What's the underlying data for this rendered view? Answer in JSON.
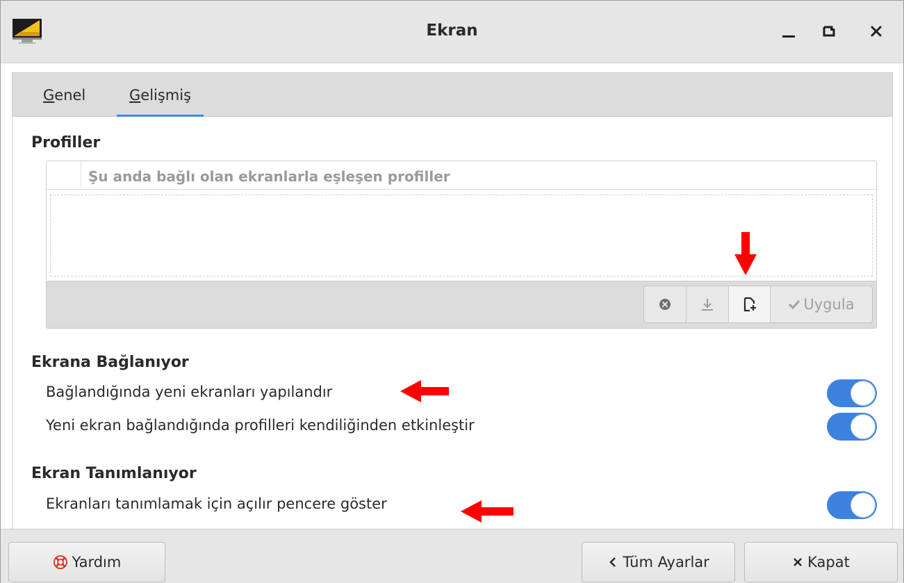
{
  "window": {
    "title": "Ekran",
    "icon": "display-settings-icon"
  },
  "tabs": [
    {
      "label": "Genel",
      "underline_char": "G",
      "active": false
    },
    {
      "label": "Gelişmiş",
      "underline_char": "G",
      "active": true
    }
  ],
  "profiles": {
    "heading": "Profiller",
    "column_title": "Şu anda bağlı olan ekranlarla eşleşen profiller",
    "items": [],
    "toolbar": {
      "delete_icon": "delete-circle-icon",
      "save_icon": "download-icon",
      "new_icon": "new-document-icon",
      "apply_label": "Uygula",
      "apply_icon": "checkmark-icon"
    }
  },
  "connecting": {
    "heading": "Ekrana Bağlanıyor",
    "options": [
      {
        "label": "Bağlandığında yeni ekranları yapılandır",
        "enabled": true
      },
      {
        "label": "Yeni ekran bağlandığında profilleri kendiliğinden etkinleştir",
        "enabled": true
      }
    ]
  },
  "identifying": {
    "heading": "Ekran Tanımlanıyor",
    "options": [
      {
        "label": "Ekranları tanımlamak için açılır pencere göster",
        "enabled": true
      }
    ]
  },
  "footer": {
    "help_label": "Yardım",
    "all_settings_label": "Tüm Ayarlar",
    "close_label": "Kapat"
  },
  "colors": {
    "accent": "#3b8be3",
    "toggle_on": "#3c82df",
    "annotation_arrow": "#ff0000"
  }
}
